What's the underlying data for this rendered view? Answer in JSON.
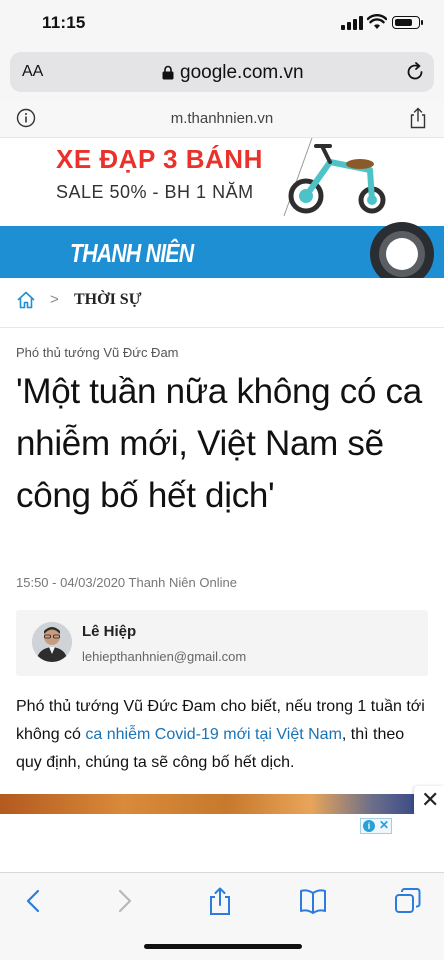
{
  "status": {
    "time": "11:15",
    "battery_level": 0.8
  },
  "browser": {
    "text_size_label": "AA",
    "url": "google.com.vn",
    "site_host": "m.thanhnien.vn"
  },
  "ad_banner": {
    "line1": "XE ĐẠP 3 BÁNH",
    "line2": "SALE 50% - BH 1 NĂM"
  },
  "site": {
    "logo": "THANH NIÊN",
    "header_color": "#1f8fd3"
  },
  "breadcrumb": {
    "separator": ">",
    "section": "THỜI SỰ"
  },
  "article": {
    "kicker": "Phó thủ tướng Vũ Đức Đam",
    "headline": "'Một tuần nữa không có ca nhiễm mới, Việt Nam sẽ công bố hết dịch'",
    "meta": "15:50 - 04/03/2020 Thanh Niên Online",
    "author": {
      "name": "Lê Hiệp",
      "email": "lehiepthanhnien@gmail.com"
    },
    "lead_before": "Phó thủ tướng Vũ Đức Đam cho biết, nếu trong 1 tuần tới không có ",
    "lead_link": "ca nhiễm Covid-19 mới tại Việt Nam",
    "lead_after": ", thì theo quy định, chúng ta sẽ công bố hết dịch."
  },
  "icons": {
    "back": "chevron-left-icon",
    "forward": "chevron-right-icon",
    "share": "share-icon",
    "bookmarks": "book-icon",
    "tabs": "tabs-icon"
  },
  "colors": {
    "link": "#1a73b5",
    "accent": "#1f8fd3",
    "ad_red": "#e8322b"
  }
}
